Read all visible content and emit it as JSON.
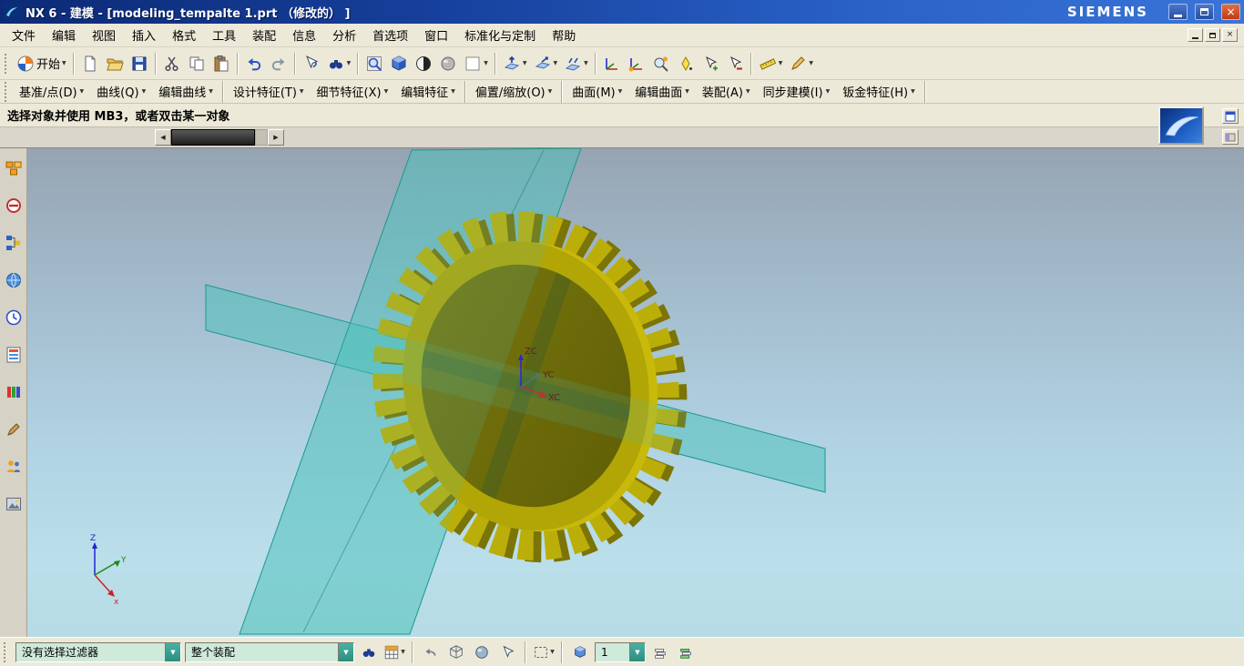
{
  "icons": {
    "caret": "▼",
    "left_arrow": "◀",
    "right_arrow": "▶",
    "close_glyph": "×"
  },
  "window": {
    "title": "NX 6 - 建模 - [modeling_tempalte 1.prt （修改的） ]",
    "brand": "SIEMENS"
  },
  "menu": {
    "items": [
      "文件",
      "编辑",
      "视图",
      "插入",
      "格式",
      "工具",
      "装配",
      "信息",
      "分析",
      "首选项",
      "窗口",
      "标准化与定制",
      "帮助"
    ]
  },
  "toolbar": {
    "start_label": "开始"
  },
  "feature_bar": {
    "items": [
      "基准/点(D)",
      "曲线(Q)",
      "编辑曲线",
      "设计特征(T)",
      "细节特征(X)",
      "编辑特征",
      "偏置/缩放(O)",
      "曲面(M)",
      "编辑曲面",
      "装配(A)",
      "同步建模(I)",
      "钣金特征(H)"
    ]
  },
  "prompt": {
    "text": "选择对象并使用 MB3，或者双击某一对象"
  },
  "viewport": {
    "wcs_labels": {
      "zc": "ZC",
      "yc": "YC",
      "xc": "XC"
    },
    "corner_triad": {
      "z": "Z",
      "y": "Y",
      "x": "x"
    }
  },
  "status_bar": {
    "selection_filter": "没有选择过滤器",
    "selection_scope": "整个装配",
    "work_layer": "1"
  },
  "colors": {
    "titlebar_blue": "#16409c",
    "plane_teal": "#49c2ba",
    "gear_yellow": "#bcae08",
    "gear_face_dark": "#6e6e0e"
  }
}
